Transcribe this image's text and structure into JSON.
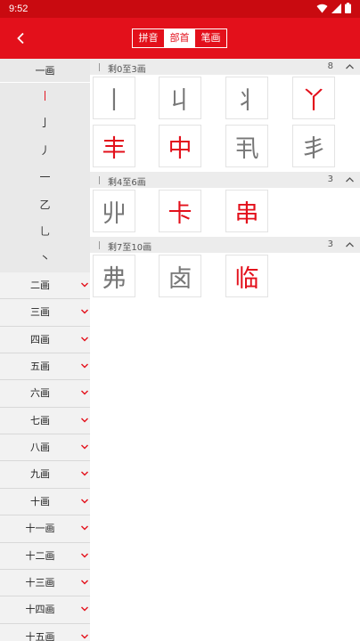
{
  "status_bar": {
    "time": "9:52"
  },
  "header": {
    "tabs": [
      {
        "label": "拼音",
        "active": false
      },
      {
        "label": "部首",
        "active": true
      },
      {
        "label": "笔画",
        "active": false
      }
    ]
  },
  "sidebar": {
    "open_group": {
      "label": "一画",
      "strokes": [
        {
          "label": "丨",
          "active": true
        },
        {
          "label": "亅",
          "active": false
        },
        {
          "label": "丿",
          "active": false
        },
        {
          "label": "一",
          "active": false
        },
        {
          "label": "乙",
          "active": false
        },
        {
          "label": "乚",
          "active": false
        },
        {
          "label": "丶",
          "active": false
        }
      ]
    },
    "groups": [
      "二画",
      "三画",
      "四画",
      "五画",
      "六画",
      "七画",
      "八画",
      "九画",
      "十画",
      "十一画",
      "十二画",
      "十三画",
      "十四画",
      "十五画"
    ]
  },
  "sections": [
    {
      "title": "剩0至3画",
      "count": "8",
      "chars": [
        {
          "c": "丨",
          "color": "gray"
        },
        {
          "c": "丩",
          "color": "gray"
        },
        {
          "c": "丬",
          "color": "gray"
        },
        {
          "c": "丫",
          "color": "red"
        },
        {
          "c": "丰",
          "color": "red"
        },
        {
          "c": "中",
          "color": "red"
        },
        {
          "c": "丮",
          "color": "gray"
        },
        {
          "c": "丯",
          "color": "gray"
        }
      ]
    },
    {
      "title": "剩4至6画",
      "count": "3",
      "chars": [
        {
          "c": "丱",
          "color": "gray"
        },
        {
          "c": "卡",
          "color": "red"
        },
        {
          "c": "串",
          "color": "red"
        }
      ]
    },
    {
      "title": "剩7至10画",
      "count": "3",
      "chars": [
        {
          "c": "弗",
          "color": "gray"
        },
        {
          "c": "卤",
          "color": "gray"
        },
        {
          "c": "临",
          "color": "red"
        }
      ]
    }
  ],
  "colors": {
    "accent": "#e3101b",
    "status_bar": "#c90a10",
    "red_char": "#e3101b",
    "gray_char": "#777777"
  },
  "icons": {
    "back": "chevron-left-icon",
    "expand": "chevron-down-icon",
    "collapse": "chevron-up-icon"
  }
}
